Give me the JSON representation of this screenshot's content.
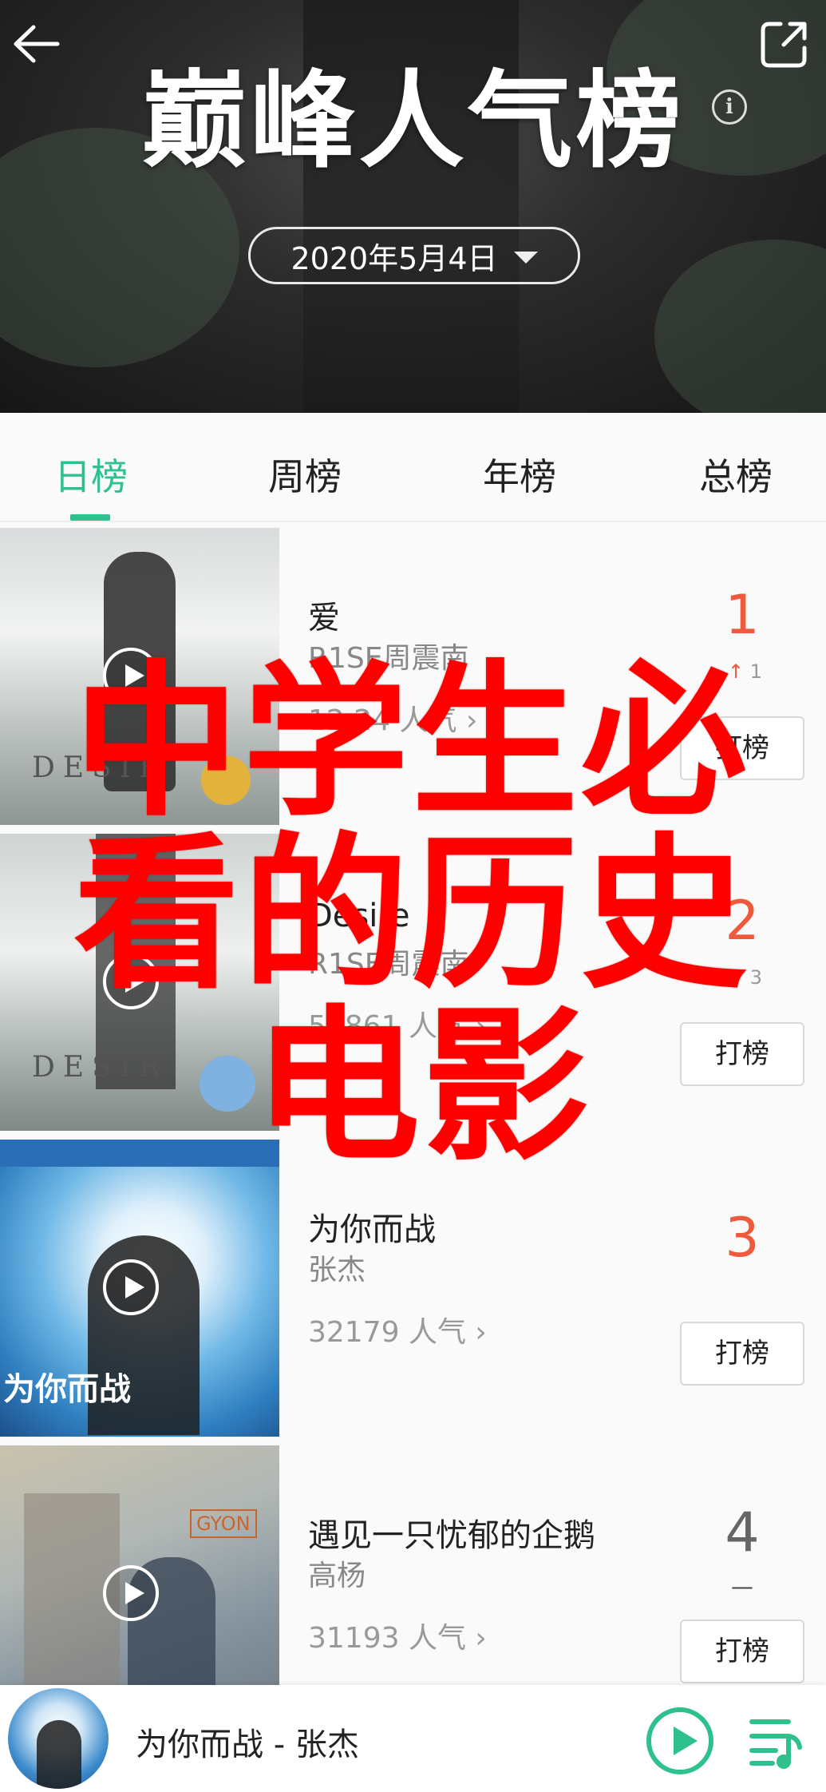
{
  "header": {
    "title": "巅峰人气榜",
    "info_icon_glyph": "i",
    "date": "2020年5月4日"
  },
  "tabs": [
    {
      "label": "日榜",
      "active": true
    },
    {
      "label": "周榜",
      "active": false
    },
    {
      "label": "年榜",
      "active": false
    },
    {
      "label": "总榜",
      "active": false
    }
  ],
  "songs": [
    {
      "title": "爱",
      "artist": "R1SE周震南",
      "popularity": "12 24 人气",
      "rank": "1",
      "change_arrow": "↑",
      "change": "1",
      "vote_label": "打榜",
      "cover_text": "DESIR"
    },
    {
      "title": "Desire",
      "artist": "R1SE周震南",
      "popularity": "51861 人气",
      "rank": "2",
      "change_arrow": "↑",
      "change": "3",
      "vote_label": "打榜",
      "cover_text": "DESIR"
    },
    {
      "title": "为你而战",
      "artist": "张杰",
      "popularity": "32179 人气",
      "rank": "3",
      "change_arrow": "",
      "change": "",
      "vote_label": "打榜",
      "cover_text": "为你而战"
    },
    {
      "title": "遇见一只忧郁的企鹅",
      "artist": "高杨",
      "popularity": "31193 人气",
      "rank": "4",
      "change_arrow": "",
      "change": "—",
      "vote_label": "打榜",
      "cover_text": "GYON"
    }
  ],
  "watermark": {
    "line1": "中学生必",
    "line2": "看的历史",
    "line3": "电影"
  },
  "player": {
    "now_playing": "为你而战 - 张杰"
  },
  "colors": {
    "accent_green": "#2fc18c",
    "rank_red": "#ef5a3d",
    "watermark_red": "#ff0000"
  },
  "icons": [
    "back-arrow-icon",
    "share-icon",
    "info-icon",
    "caret-down-icon",
    "play-icon",
    "chevron-right-icon",
    "play-circle-icon",
    "playlist-icon"
  ]
}
